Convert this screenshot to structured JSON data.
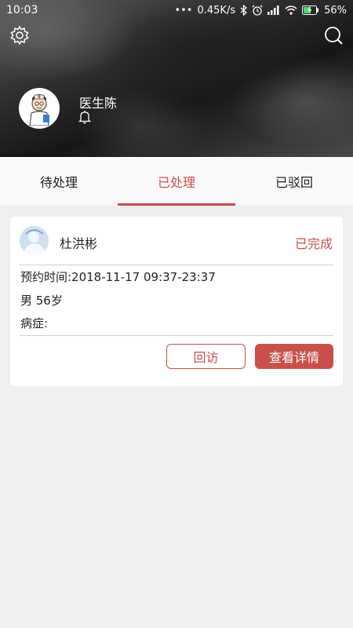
{
  "status_bar": {
    "time": "10:03",
    "network_speed": "0.45K/s",
    "battery": "56%"
  },
  "header": {
    "settings_icon": "gear-icon",
    "search_icon": "search-icon",
    "doctor_name": "医生陈",
    "bell_icon": "bell-icon"
  },
  "tabs": [
    {
      "label": "待处理",
      "active": false
    },
    {
      "label": "已处理",
      "active": true
    },
    {
      "label": "已驳回",
      "active": false
    }
  ],
  "record": {
    "patient_name": "杜洪彬",
    "status": "已完成",
    "appointment_time": "预约时间:2018-11-17 09:37-23:37",
    "gender_age": "男 56岁",
    "disease": "病症:",
    "followup_label": "回访",
    "details_label": "查看详情"
  },
  "colors": {
    "accent": "#c9504a",
    "background": "#efefef"
  }
}
